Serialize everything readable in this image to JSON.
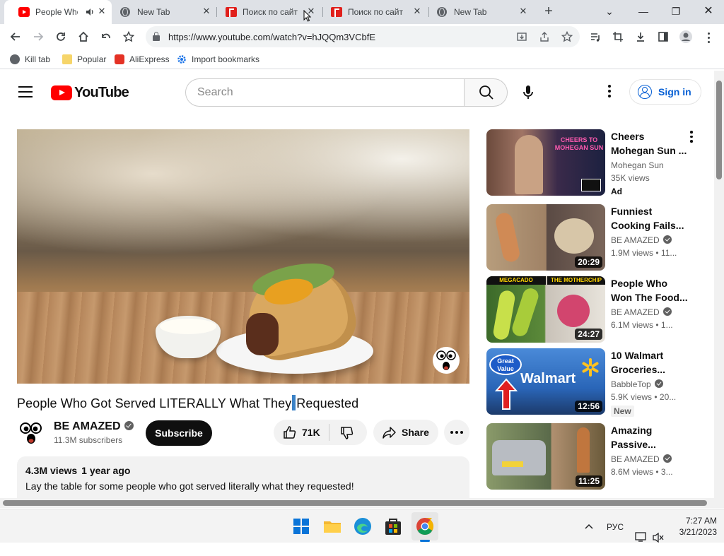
{
  "browser": {
    "tabs": [
      {
        "title": "People Who",
        "favicon": "youtube-favicon",
        "active": true,
        "audio": true
      },
      {
        "title": "New Tab",
        "favicon": "globe-favicon",
        "active": false
      },
      {
        "title": "Поиск по сайт",
        "favicon": "yandex-favicon",
        "active": false
      },
      {
        "title": "Поиск по сайт",
        "favicon": "yandex-favicon",
        "active": false
      },
      {
        "title": "New Tab",
        "favicon": "globe-favicon",
        "active": false
      }
    ],
    "url": "https://www.youtube.com/watch?v=hJQQm3VCbfE",
    "bookmarks": [
      {
        "label": "Kill tab",
        "icon": "globe-icon"
      },
      {
        "label": "Popular",
        "icon": "folder-icon"
      },
      {
        "label": "AliExpress",
        "icon": "aliexpress-icon"
      },
      {
        "label": "Import bookmarks",
        "icon": "gear-icon"
      }
    ]
  },
  "youtube": {
    "logo_text": "YouTube",
    "search_placeholder": "Search",
    "signin_label": "Sign in",
    "video": {
      "title_before": "People Who Got Served LITERALLY What They",
      "title_after": "Requested",
      "channel": "BE AMAZED",
      "subscribers": "11.3M subscribers",
      "subscribe_label": "Subscribe",
      "likes": "71K",
      "share_label": "Share",
      "views": "4.3M views",
      "age": "1 year ago",
      "description": "Lay the table for some people who got served literally what they requested!"
    },
    "related": [
      {
        "title": "Cheers Mohegan Sun ...",
        "channel": "Mohegan Sun",
        "verified": false,
        "views": "35K views",
        "age": "",
        "badge": "Ad",
        "duration": ""
      },
      {
        "title": "Funniest Cooking Fails...",
        "channel": "BE AMAZED",
        "verified": true,
        "views": "1.9M views",
        "age": "11...",
        "badge": "",
        "duration": "20:29"
      },
      {
        "title": "People Who Won The Food...",
        "channel": "BE AMAZED",
        "verified": true,
        "views": "6.1M views",
        "age": "1...",
        "badge": "",
        "duration": "24:27"
      },
      {
        "title": "10 Walmart Groceries...",
        "channel": "BabbleTop",
        "verified": true,
        "views": "5.9K views",
        "age": "20...",
        "badge": "New",
        "duration": "12:56"
      },
      {
        "title": "Amazing Passive...",
        "channel": "BE AMAZED",
        "verified": true,
        "views": "8.6M views",
        "age": "3...",
        "badge": "",
        "duration": "11:25"
      }
    ],
    "thumb_text": {
      "t1": "CHEERS TO MOHEGAN SUN",
      "t3a": "MEGACADO",
      "t3b": "THE MOTHERCHIP",
      "t4a": "Great Value",
      "t4b": "Walmart"
    }
  },
  "taskbar": {
    "apps": [
      "windows-start-icon",
      "file-explorer-icon",
      "edge-icon",
      "store-icon",
      "chrome-icon"
    ],
    "language": "РУС",
    "time": "7:27 AM",
    "date": "3/21/2023"
  },
  "colors": {
    "youtube_red": "#ff0000",
    "link_blue": "#065fd4",
    "chrome_tabstrip": "#dee1e6"
  }
}
